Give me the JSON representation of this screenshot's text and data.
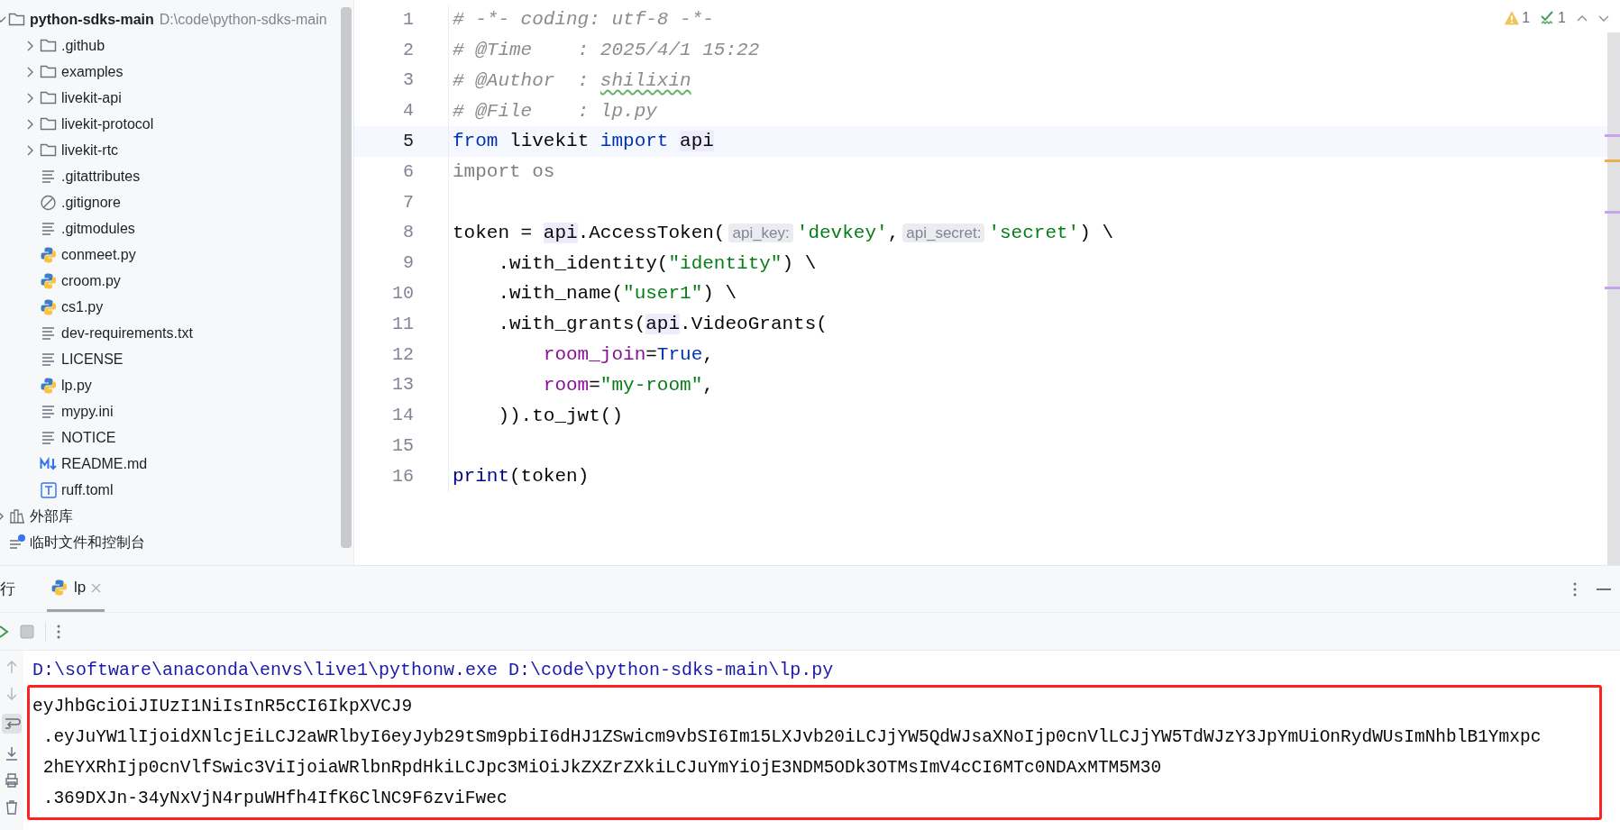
{
  "project_tree": {
    "items": [
      {
        "name": "python-sdks-main",
        "path": "D:\\code\\python-sdks-main",
        "kind": "root",
        "expanded": true,
        "children": [
          {
            "name": ".github",
            "kind": "folder",
            "expanded": false
          },
          {
            "name": "examples",
            "kind": "folder",
            "expanded": false
          },
          {
            "name": "livekit-api",
            "kind": "folder",
            "expanded": false
          },
          {
            "name": "livekit-protocol",
            "kind": "folder",
            "expanded": false
          },
          {
            "name": "livekit-rtc",
            "kind": "folder",
            "expanded": false
          },
          {
            "name": ".gitattributes",
            "kind": "text"
          },
          {
            "name": ".gitignore",
            "kind": "ignore"
          },
          {
            "name": ".gitmodules",
            "kind": "text"
          },
          {
            "name": "conmeet.py",
            "kind": "python"
          },
          {
            "name": "croom.py",
            "kind": "python"
          },
          {
            "name": "cs1.py",
            "kind": "python"
          },
          {
            "name": "dev-requirements.txt",
            "kind": "text"
          },
          {
            "name": "LICENSE",
            "kind": "text"
          },
          {
            "name": "lp.py",
            "kind": "python"
          },
          {
            "name": "mypy.ini",
            "kind": "text"
          },
          {
            "name": "NOTICE",
            "kind": "text"
          },
          {
            "name": "README.md",
            "kind": "markdown"
          },
          {
            "name": "ruff.toml",
            "kind": "toml"
          }
        ]
      },
      {
        "name": "外部库",
        "kind": "library",
        "expanded": false
      },
      {
        "name": "临时文件和控制台",
        "kind": "scratches"
      }
    ]
  },
  "editor": {
    "inspections": [
      {
        "kind": "warning",
        "count": "1"
      },
      {
        "kind": "typo",
        "count": "1"
      }
    ],
    "lines": [
      {
        "number": "1",
        "current": false,
        "tokens": [
          {
            "t": "# -*- coding: utf-8 -*-",
            "kind": "comment"
          }
        ]
      },
      {
        "number": "2",
        "current": false,
        "tokens": [
          {
            "t": "# @Time    : 2025/4/1 15:22",
            "kind": "comment"
          }
        ]
      },
      {
        "number": "3",
        "current": false,
        "tokens": [
          {
            "t": "# @Author  : ",
            "kind": "comment"
          },
          {
            "t": "shilixin",
            "kind": "typo"
          }
        ]
      },
      {
        "number": "4",
        "current": false,
        "tokens": [
          {
            "t": "# @File    : lp.py",
            "kind": "comment"
          }
        ]
      },
      {
        "number": "5",
        "current": true,
        "tokens": [
          {
            "t": "from",
            "kind": "keyword"
          },
          {
            "t": " livekit ",
            "kind": "plain"
          },
          {
            "t": "import ",
            "kind": "keyword"
          },
          {
            "t": "api",
            "kind": "ref"
          }
        ]
      },
      {
        "number": "6",
        "current": false,
        "tokens": [
          {
            "t": "import os",
            "kind": "unused"
          }
        ]
      },
      {
        "number": "7",
        "current": false
      },
      {
        "number": "8",
        "current": false,
        "tokens": [
          {
            "t": "token = ",
            "kind": "plain"
          },
          {
            "t": "api",
            "kind": "ref"
          },
          {
            "t": ".AccessToken(",
            "kind": "plain"
          },
          {
            "t": "api_key:",
            "kind": "hint"
          },
          {
            "t": "'devkey'",
            "kind": "string"
          },
          {
            "t": ",",
            "kind": "plain"
          },
          {
            "t": "api_secret:",
            "kind": "hint"
          },
          {
            "t": "'secret'",
            "kind": "string"
          },
          {
            "t": ") \\",
            "kind": "plain"
          }
        ]
      },
      {
        "number": "9",
        "current": false,
        "tokens": [
          {
            "t": "    .with_identity(",
            "kind": "plain"
          },
          {
            "t": "\"identity\"",
            "kind": "string"
          },
          {
            "t": ") \\",
            "kind": "plain"
          }
        ]
      },
      {
        "number": "10",
        "current": false,
        "tokens": [
          {
            "t": "    .with_name(",
            "kind": "plain"
          },
          {
            "t": "\"user1\"",
            "kind": "string"
          },
          {
            "t": ") \\",
            "kind": "plain"
          }
        ]
      },
      {
        "number": "11",
        "current": false,
        "tokens": [
          {
            "t": "    .with_grants(",
            "kind": "plain"
          },
          {
            "t": "api",
            "kind": "ref"
          },
          {
            "t": ".VideoGrants(",
            "kind": "plain"
          }
        ]
      },
      {
        "number": "12",
        "current": false,
        "tokens": [
          {
            "t": "        room_join",
            "kind": "param"
          },
          {
            "t": "=",
            "kind": "plain"
          },
          {
            "t": "True",
            "kind": "const"
          },
          {
            "t": ",",
            "kind": "plain"
          }
        ]
      },
      {
        "number": "13",
        "current": false,
        "tokens": [
          {
            "t": "        room",
            "kind": "param"
          },
          {
            "t": "=",
            "kind": "plain"
          },
          {
            "t": "\"my-room\"",
            "kind": "string"
          },
          {
            "t": ",",
            "kind": "plain"
          }
        ]
      },
      {
        "number": "14",
        "current": false,
        "tokens": [
          {
            "t": "    )).to_jwt()",
            "kind": "plain"
          }
        ]
      },
      {
        "number": "15",
        "current": false
      },
      {
        "number": "16",
        "current": false,
        "tokens": [
          {
            "t": "print",
            "kind": "builtin"
          },
          {
            "t": "(token)",
            "kind": "plain"
          }
        ]
      }
    ]
  },
  "run_panel": {
    "title": "行",
    "tabs": [
      {
        "label": "lp",
        "selected": true
      }
    ],
    "command": "D:\\software\\anaconda\\envs\\live1\\pythonw.exe D:\\code\\python-sdks-main\\lp.py",
    "output_highlighted": true,
    "output_lines": [
      "eyJhbGciOiJIUzI1NiIsInR5cCI6IkpXVCJ9",
      " .eyJuYW1lIjoidXNlcjEiLCJ2aWRlbyI6eyJyb29tSm9pbiI6dHJ1ZSwicm9vbSI6Im15LXJvb20iLCJjYW5QdWJsaXNoIjp0cnVlLCJjYW5TdWJzY3JpYmUiOnRydWUsImNhblB1Ymxpc",
      " 2hEYXRhIjp0cnVlfSwic3ViIjoiaWRlbnRpdHkiLCJpc3MiOiJkZXZrZXkiLCJuYmYiOjE3NDM5ODk3OTMsImV4cCI6MTc0NDAxMTM5M30",
      " .369DXJn-34yNxVjN4rpuWHfh4IfK6ClNC9F6zviFwec"
    ]
  }
}
